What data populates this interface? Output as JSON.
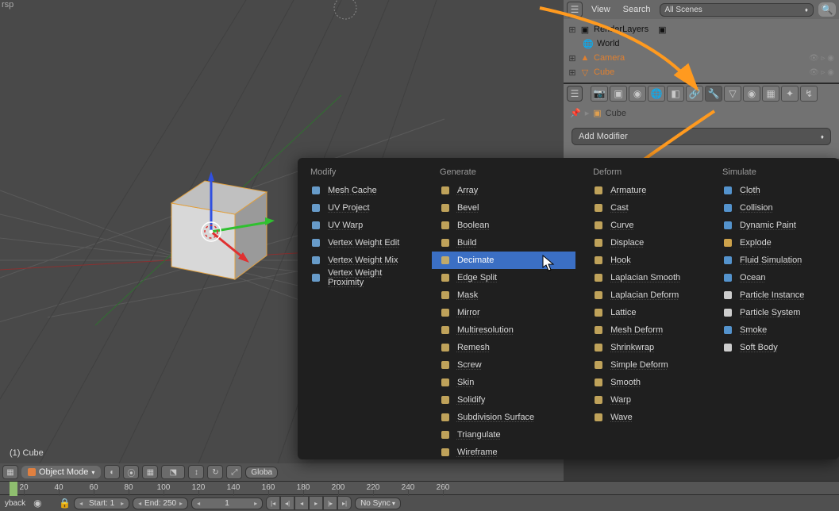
{
  "viewport": {
    "top_label": "rsp",
    "object_label": "(1) Cube"
  },
  "header": {
    "mode": "Object Mode",
    "global": "Globa"
  },
  "timeline": {
    "ticks": [
      "20",
      "40",
      "60",
      "80",
      "100",
      "120",
      "140",
      "160",
      "180",
      "200",
      "220",
      "240",
      "260"
    ],
    "playback_label": "yback",
    "start_label": "Start:",
    "start_value": "1",
    "end_label": "End:",
    "end_value": "250",
    "current_frame": "1",
    "sync": "No Sync"
  },
  "outliner": {
    "menu_view": "View",
    "menu_search": "Search",
    "scene_filter": "All Scenes",
    "items": [
      {
        "label": "RenderLayers",
        "indent": 1,
        "expander": "⊞",
        "color": "#ccc"
      },
      {
        "label": "World",
        "indent": 1,
        "color": "#333"
      },
      {
        "label": "Camera",
        "indent": 1,
        "expander": "⊞",
        "color": "#e08030"
      },
      {
        "label": "Cube",
        "indent": 1,
        "expander": "⊞",
        "color": "#e08030"
      }
    ]
  },
  "properties": {
    "breadcrumb_obj": "Cube",
    "add_modifier_label": "Add Modifier"
  },
  "modifier_menu": {
    "highlighted": "Decimate",
    "columns": [
      {
        "header": "Modify",
        "items": [
          {
            "icon": "#6fa8dc",
            "label": "Mesh Cache"
          },
          {
            "icon": "#6fa8dc",
            "label": "UV Project"
          },
          {
            "icon": "#6fa8dc",
            "label": "UV Warp"
          },
          {
            "icon": "#6fa8dc",
            "label": "Vertex Weight Edit"
          },
          {
            "icon": "#6fa8dc",
            "label": "Vertex Weight Mix"
          },
          {
            "icon": "#6fa8dc",
            "label": "Vertex Weight Proximity"
          }
        ]
      },
      {
        "header": "Generate",
        "items": [
          {
            "icon": "#d0b060",
            "label": "Array"
          },
          {
            "icon": "#d0b060",
            "label": "Bevel"
          },
          {
            "icon": "#d0b060",
            "label": "Boolean"
          },
          {
            "icon": "#d0b060",
            "label": "Build"
          },
          {
            "icon": "#d0b060",
            "label": "Decimate"
          },
          {
            "icon": "#d0b060",
            "label": "Edge Split"
          },
          {
            "icon": "#d0b060",
            "label": "Mask"
          },
          {
            "icon": "#d0b060",
            "label": "Mirror"
          },
          {
            "icon": "#d0b060",
            "label": "Multiresolution"
          },
          {
            "icon": "#d0b060",
            "label": "Remesh"
          },
          {
            "icon": "#d0b060",
            "label": "Screw"
          },
          {
            "icon": "#d0b060",
            "label": "Skin"
          },
          {
            "icon": "#d0b060",
            "label": "Solidify"
          },
          {
            "icon": "#d0b060",
            "label": "Subdivision Surface"
          },
          {
            "icon": "#d0b060",
            "label": "Triangulate"
          },
          {
            "icon": "#d0b060",
            "label": "Wireframe"
          }
        ]
      },
      {
        "header": "Deform",
        "items": [
          {
            "icon": "#d0b060",
            "label": "Armature"
          },
          {
            "icon": "#d0b060",
            "label": "Cast"
          },
          {
            "icon": "#d0b060",
            "label": "Curve"
          },
          {
            "icon": "#d0b060",
            "label": "Displace"
          },
          {
            "icon": "#d0b060",
            "label": "Hook"
          },
          {
            "icon": "#d0b060",
            "label": "Laplacian Smooth"
          },
          {
            "icon": "#d0b060",
            "label": "Laplacian Deform"
          },
          {
            "icon": "#d0b060",
            "label": "Lattice"
          },
          {
            "icon": "#d0b060",
            "label": "Mesh Deform"
          },
          {
            "icon": "#d0b060",
            "label": "Shrinkwrap"
          },
          {
            "icon": "#d0b060",
            "label": "Simple Deform"
          },
          {
            "icon": "#d0b060",
            "label": "Smooth"
          },
          {
            "icon": "#d0b060",
            "label": "Warp"
          },
          {
            "icon": "#d0b060",
            "label": "Wave"
          }
        ]
      },
      {
        "header": "Simulate",
        "items": [
          {
            "icon": "#5aa0e0",
            "label": "Cloth"
          },
          {
            "icon": "#5aa0e0",
            "label": "Collision"
          },
          {
            "icon": "#5aa0e0",
            "label": "Dynamic Paint"
          },
          {
            "icon": "#e0b050",
            "label": "Explode"
          },
          {
            "icon": "#5aa0e0",
            "label": "Fluid Simulation"
          },
          {
            "icon": "#5aa0e0",
            "label": "Ocean"
          },
          {
            "icon": "#e0e0e0",
            "label": "Particle Instance"
          },
          {
            "icon": "#e0e0e0",
            "label": "Particle System"
          },
          {
            "icon": "#5aa0e0",
            "label": "Smoke"
          },
          {
            "icon": "#e0e0e0",
            "label": "Soft Body"
          }
        ]
      }
    ]
  }
}
